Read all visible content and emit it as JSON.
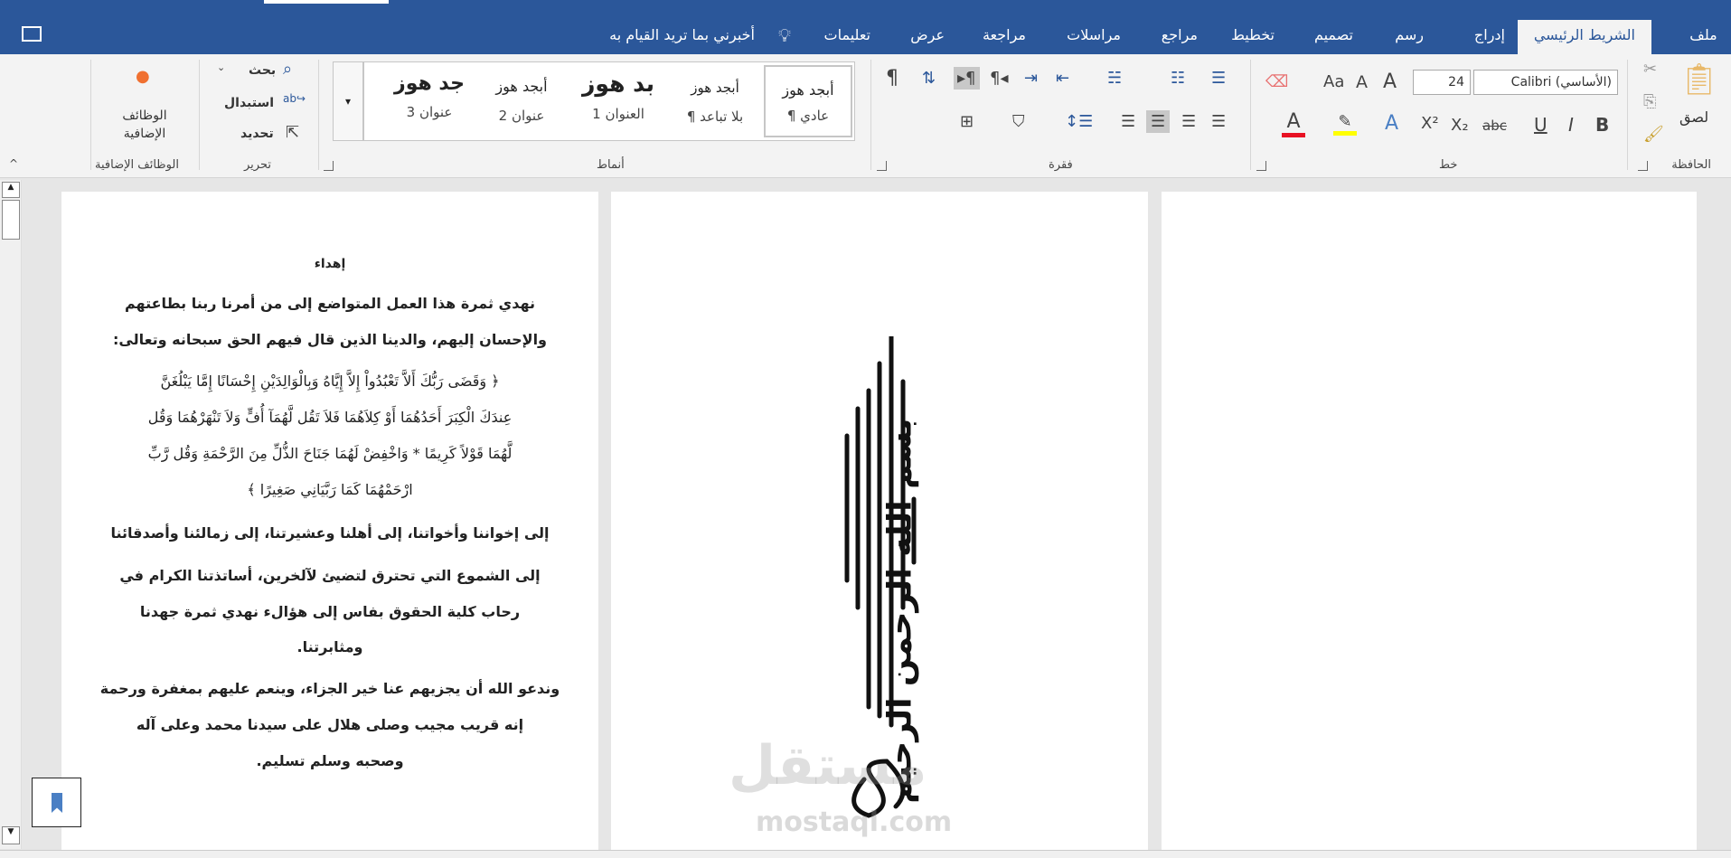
{
  "tabs": [
    {
      "label": "ملف"
    },
    {
      "label": "الشريط الرئيسي"
    },
    {
      "label": "إدراج"
    },
    {
      "label": "رسم"
    },
    {
      "label": "تصميم"
    },
    {
      "label": "تخطيط"
    },
    {
      "label": "مراجع"
    },
    {
      "label": "مراسلات"
    },
    {
      "label": "مراجعة"
    },
    {
      "label": "عرض"
    },
    {
      "label": "تعليمات"
    }
  ],
  "tell_me": "أخبرني بما تريد القيام به",
  "clipboard": {
    "label": "الحافظة",
    "paste": "لصق"
  },
  "font": {
    "label": "خط",
    "name": "Calibri (الأساسي)",
    "size": "24",
    "change_case": "Aa"
  },
  "paragraph": {
    "label": "فقرة"
  },
  "styles": {
    "label": "أنماط",
    "items": [
      {
        "sample": "أبجد هوز",
        "name": "¶ عادي"
      },
      {
        "sample": "أبجد هوز",
        "name": "¶ بلا تباعد"
      },
      {
        "sample": "بد هوز",
        "name": "العنوان 1"
      },
      {
        "sample": "أبجد هوز",
        "name": "عنوان 2"
      },
      {
        "sample": "جد هوز",
        "name": "عنوان 3"
      }
    ]
  },
  "editing": {
    "label": "تحرير",
    "find": "بحث",
    "replace": "استبدال",
    "select": "تحديد"
  },
  "addins": {
    "label": "الوظائف الإضافية",
    "button": "الوظائف الإضافية"
  },
  "document": {
    "title": "إهداء",
    "lines": [
      "نهدي ثمرة هذا العمل المتواضع إلى من أمرنا ربنا بطاعتهم",
      "والإحسان إليهم، والدينا الذين قال فيهم الحق سبحانه وتعالى:",
      "﴿ وَقَضَى رَبُّكَ أَلاَّ تَعْبُدُواْ إِلاَّ إِيَّاهُ وَبِالْوَالِدَيْنِ إِحْسَانًا إِمَّا يَبْلُغَنَّ",
      "عِندَكَ الْكِبَرَ أَحَدُهُمَا أَوْ كِلاَهُمَا فَلاَ تَقُل لَّهُمَآ أُفٍّ وَلاَ تَنْهَرْهُمَا وَقُل",
      "لَّهُمَا قَوْلاً كَرِيمًا * وَاخْفِضْ لَهُمَا جَنَاحَ الذُّلِّ مِنَ الرَّحْمَةِ وَقُل رَّبِّ",
      "ارْحَمْهُمَا كَمَا رَبَّيَانِي صَغِيرًا ﴾",
      "إلى إخواننا وأخواتنا، إلى أهلنا وعشيرتنا، إلى زمالئنا وأصدقائنا",
      "إلى الشموع التي تحترق لتضيئ لآلخرين، أساتذتنا الكرام في",
      "رحاب كلية الحقوق بفاس إلى هؤالء نهدي ثمرة جهدنا",
      "ومثابرتنا.",
      "وندعو الله أن يجزيهم عنا خير الجزاء، وينعم عليهم بمغفرة ورحمة",
      "إنه قريب مجيب وصلى هلال على سيدنا محمد وعلى آله",
      "وصحبه وسلم تسليم."
    ],
    "calligraphy": "بسم الله الرحمن الرحيم",
    "watermark": {
      "arabic": "مستقل",
      "latin": "mostaql.com"
    }
  },
  "colors": {
    "accent": "#2b579a",
    "font_color": "#e81123",
    "highlight": "#ffff00"
  }
}
